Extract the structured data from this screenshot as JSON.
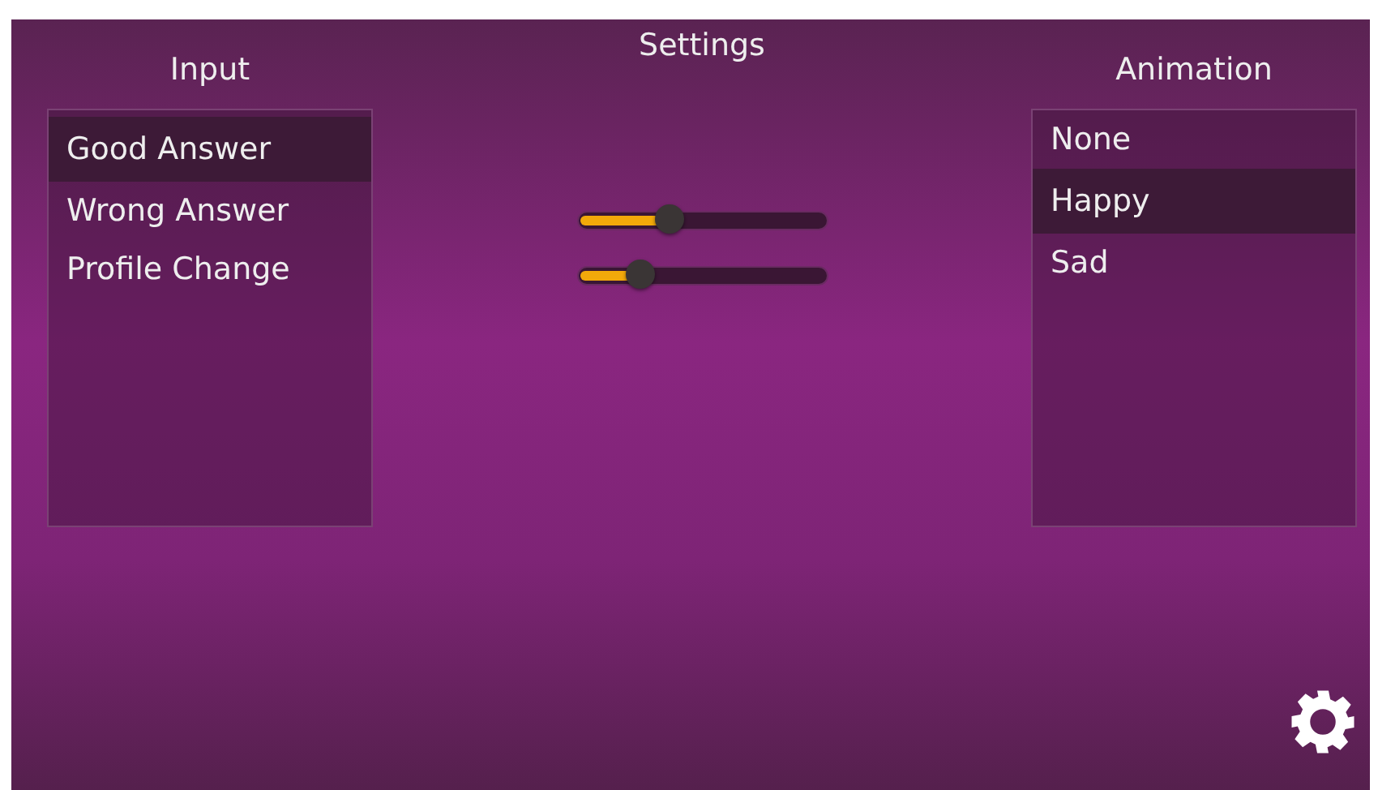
{
  "title": "Settings",
  "input": {
    "heading": "Input",
    "items": [
      {
        "label": "Good Answer",
        "selected": true
      },
      {
        "label": "Wrong Answer",
        "selected": false
      },
      {
        "label": "Profile Change",
        "selected": false
      }
    ]
  },
  "sliders": [
    {
      "level": 0.37
    },
    {
      "level": 0.25
    }
  ],
  "animation": {
    "heading": "Animation",
    "items": [
      {
        "label": "None",
        "selected": false
      },
      {
        "label": "Happy",
        "selected": true
      },
      {
        "label": "Sad",
        "selected": false
      }
    ]
  }
}
